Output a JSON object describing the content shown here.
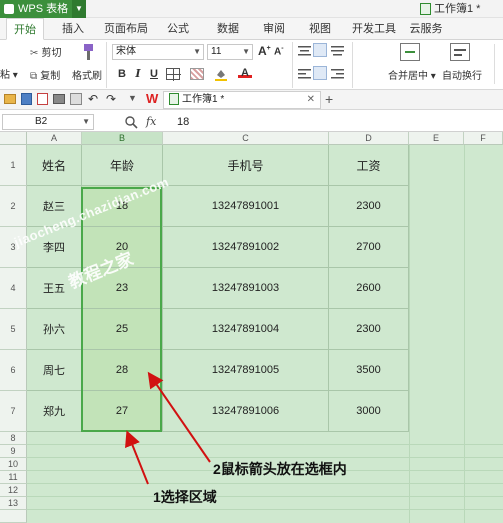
{
  "app": {
    "title": "WPS 表格",
    "window_title": "工作簿1 *"
  },
  "tabs": [
    "开始",
    "插入",
    "页面布局",
    "公式",
    "数据",
    "审阅",
    "视图",
    "开发工具",
    "云服务"
  ],
  "ribbon": {
    "cut": "剪切",
    "copy": "复制",
    "format_painter": "格式刷",
    "paste": "粘",
    "font_name": "宋体",
    "font_size": "11",
    "merge_center": "合并居中",
    "wrap_text": "自动换行"
  },
  "quick_access": {
    "doc_tab": "工作簿1 *",
    "add_tab": "+"
  },
  "formula_bar": {
    "cell_ref": "B2",
    "fx": "fx",
    "value": "18"
  },
  "columns": [
    "A",
    "B",
    "C",
    "D",
    "E",
    "F"
  ],
  "rows": [
    "1",
    "2",
    "3",
    "4",
    "5",
    "6",
    "7",
    "8",
    "9",
    "10",
    "11",
    "12",
    "13"
  ],
  "table": {
    "headers": [
      "姓名",
      "年龄",
      "手机号",
      "工资"
    ],
    "data": [
      [
        "赵三",
        "18",
        "13247891001",
        "2300"
      ],
      [
        "李四",
        "20",
        "13247891002",
        "2700"
      ],
      [
        "王五",
        "23",
        "13247891003",
        "2600"
      ],
      [
        "孙六",
        "25",
        "13247891004",
        "2300"
      ],
      [
        "周七",
        "28",
        "13247891005",
        "3500"
      ],
      [
        "郑九",
        "27",
        "13247891006",
        "3000"
      ]
    ]
  },
  "watermark": {
    "line1": "jiaocheng.chazidian.com",
    "line2": "教程之家"
  },
  "annotations": {
    "a1": "1选择区域",
    "a2": "2鼠标箭头放在选框内"
  },
  "colors": {
    "brand": "#3c8f3c",
    "selection": "#4aa84a",
    "grid": "#cfe8cf",
    "arrow": "#d11111"
  }
}
